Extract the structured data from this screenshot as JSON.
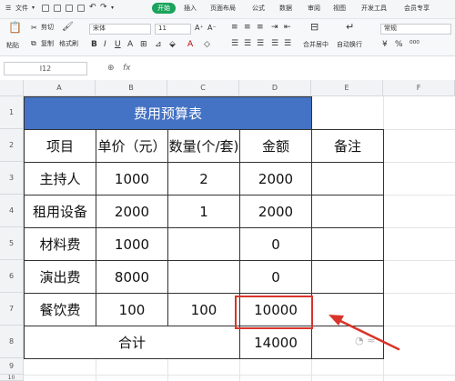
{
  "menubar": {
    "file_label": "文件",
    "tabs": [
      "开始",
      "插入",
      "页面布局",
      "公式",
      "数据",
      "审阅",
      "视图",
      "开发工具",
      "会员专享"
    ],
    "active_tab": "开始"
  },
  "ribbon": {
    "paste_label": "粘贴",
    "cut_label": "剪切",
    "copy_label": "复制",
    "format_painter_label": "格式刷",
    "font_name": "宋体",
    "font_size": "11",
    "merge_label": "合并居中",
    "wrap_label": "自动换行",
    "number_format": "常规",
    "colors": {
      "accent": "#1aa35a"
    }
  },
  "formula_bar": {
    "name_box": "I12",
    "fx_label": "fx",
    "formula": ""
  },
  "sheet": {
    "columns": [
      "A",
      "B",
      "C",
      "D",
      "E",
      "F"
    ],
    "rows": [
      "1",
      "2",
      "3",
      "4",
      "5",
      "6",
      "7",
      "8",
      "9",
      "10"
    ],
    "title": "费用预算表",
    "headers": [
      "项目",
      "单价（元）",
      "数量(个/套)",
      "金额",
      "备注"
    ],
    "data": [
      [
        "主持人",
        "1000",
        "2",
        "2000",
        ""
      ],
      [
        "租用设备",
        "2000",
        "1",
        "2000",
        ""
      ],
      [
        "材料费",
        "1000",
        "",
        "0",
        ""
      ],
      [
        "演出费",
        "8000",
        "",
        "0",
        ""
      ],
      [
        "餐饮费",
        "100",
        "100",
        "10000",
        ""
      ]
    ],
    "total_label": "合计",
    "total_value": "14000",
    "title_fill": "#4472c4",
    "highlight_color": "#d9342b"
  }
}
